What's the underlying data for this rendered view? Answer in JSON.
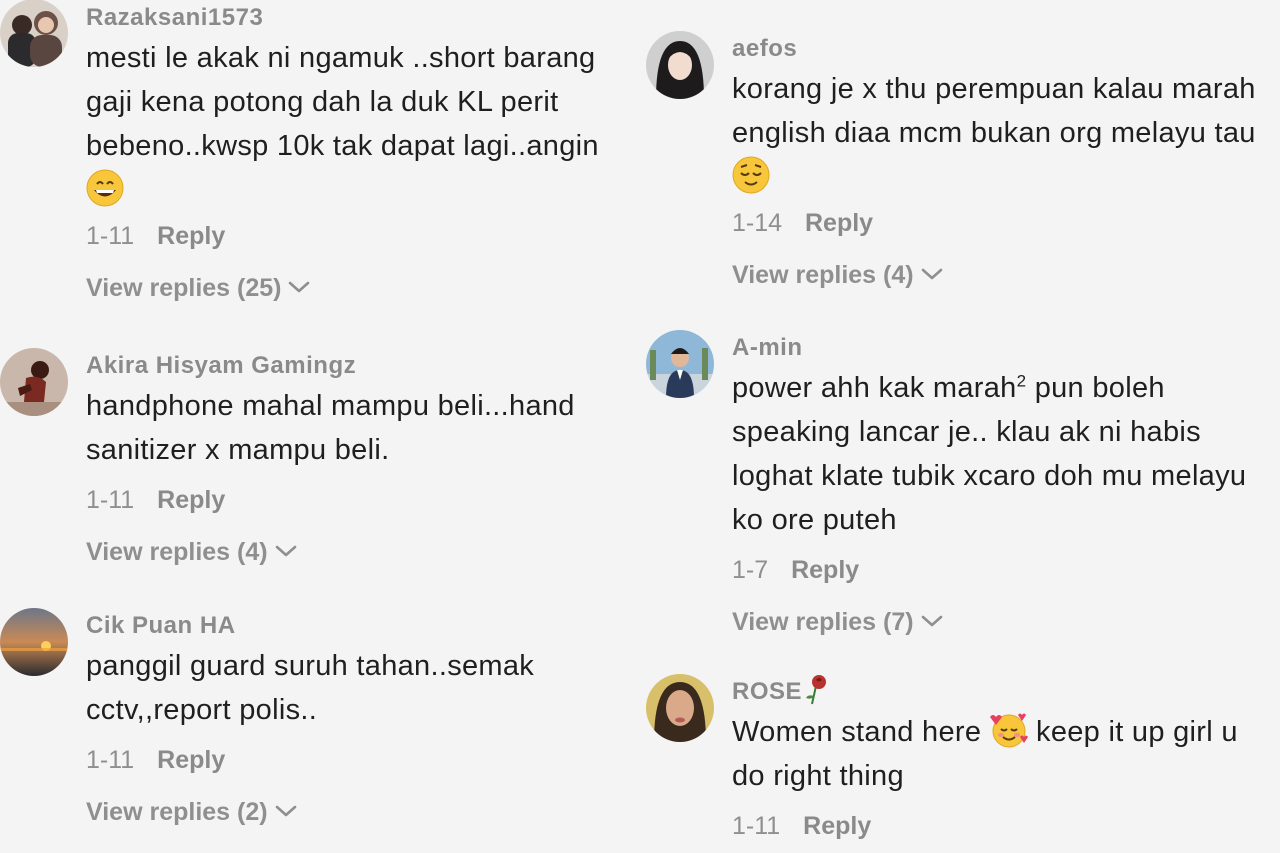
{
  "left_comments": [
    {
      "username": "Razaksani1573",
      "lines": [
        "mesti le akak ni ngamuk ..short barang",
        "gaji kena potong dah la duk KL perit",
        "bebeno..kwsp 10k tak dapat lagi..angin"
      ],
      "emoji": "grinning-face-emoji",
      "date": "1-11",
      "reply": "Reply",
      "view_replies": "View replies (25)"
    },
    {
      "username": "Akira Hisyam Gamingz",
      "lines": [
        "handphone mahal mampu beli...hand",
        "sanitizer x mampu beli."
      ],
      "date": "1-11",
      "reply": "Reply",
      "view_replies": "View replies (4)"
    },
    {
      "username": "Cik Puan HA",
      "lines": [
        "panggil guard suruh tahan..semak",
        "cctv,,report polis.."
      ],
      "date": "1-11",
      "reply": "Reply",
      "view_replies": "View replies (2)"
    }
  ],
  "right_comments": [
    {
      "username": "aefos",
      "lines": [
        "korang je x thu perempuan kalau marah",
        "english diaa mcm bukan org melayu tau"
      ],
      "emoji": "relieved-face-emoji",
      "date": "1-14",
      "reply": "Reply",
      "view_replies": "View replies (4)"
    },
    {
      "username": "A-min",
      "line1_a": "power ahh kak marah",
      "line1_sup": "2",
      "line1_b": " pun boleh",
      "lines": [
        "speaking lancar je.. klau ak ni habis",
        "loghat klate tubik xcaro doh mu melayu",
        "ko ore puteh"
      ],
      "date": "1-7",
      "reply": "Reply",
      "view_replies": "View replies (7)"
    },
    {
      "username": "ROSE",
      "username_emoji": "wilted-rose-emoji",
      "line1_a": "Women stand here ",
      "line1_emoji": "smiling-face-with-hearts-emoji",
      "line1_b": " keep it up girl u",
      "lines": [
        "do right thing"
      ],
      "date": "1-11",
      "reply": "Reply"
    }
  ],
  "icons": {
    "chevron": "chevron-down-icon"
  },
  "colors": {
    "background": "#f4f4f4",
    "text": "#1f1f1f",
    "muted": "#8a8a8a"
  }
}
